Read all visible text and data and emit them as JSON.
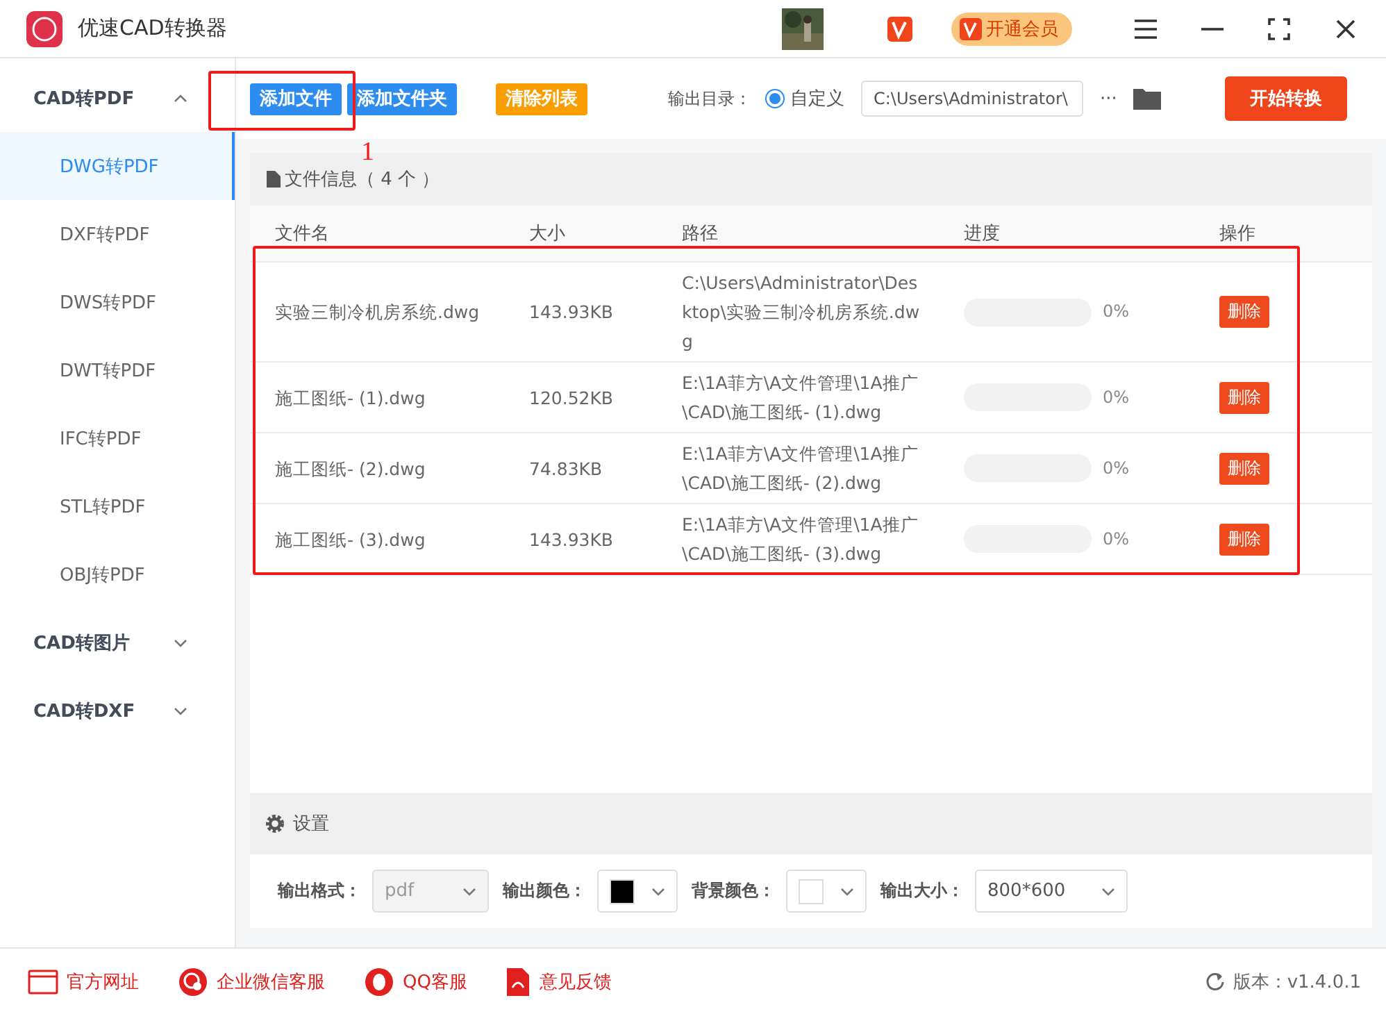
{
  "app": {
    "title": "优速CAD转换器",
    "vip_button": "开通会员"
  },
  "sidebar": {
    "groups": [
      {
        "label": "CAD转PDF",
        "expanded": true,
        "children": [
          {
            "label": "DWG转PDF",
            "selected": true
          },
          {
            "label": "DXF转PDF",
            "selected": false
          },
          {
            "label": "DWS转PDF",
            "selected": false
          },
          {
            "label": "DWT转PDF",
            "selected": false
          },
          {
            "label": "IFC转PDF",
            "selected": false
          },
          {
            "label": "STL转PDF",
            "selected": false
          },
          {
            "label": "OBJ转PDF",
            "selected": false
          }
        ]
      },
      {
        "label": "CAD转图片",
        "expanded": false
      },
      {
        "label": "CAD转DXF",
        "expanded": false
      }
    ]
  },
  "toolbar": {
    "buttons": [
      {
        "label": "添加文件",
        "kind": "primary"
      },
      {
        "label": "添加文件夹",
        "kind": "primary"
      },
      {
        "label": "清除列表",
        "kind": "warning"
      }
    ],
    "output_label": "输出目录：",
    "radio": {
      "label": "自定义",
      "selected": true
    },
    "path": "C:\\Users\\Administrator\\",
    "more": "···",
    "start": "开始转换"
  },
  "annotation": {
    "label": "1"
  },
  "file_info": {
    "title": "文件信息（ 4 个 ）"
  },
  "table": {
    "columns": [
      "文件名",
      "大小",
      "路径",
      "进度",
      "操作"
    ],
    "rows": [
      {
        "name": "实验三制冷机房系统.dwg",
        "size": "143.93KB",
        "path": "C:\\Users\\Administrator\\Desktop\\实验三制冷机房系统.dwg",
        "level": 0,
        "progress": "0%",
        "action": "删除"
      },
      {
        "name": "施工图纸- (1).dwg",
        "size": "120.52KB",
        "path": "E:\\1A菲方\\A文件管理\\1A推广\\CAD\\施工图纸- (1).dwg",
        "level": 0,
        "progress": "0%",
        "action": "删除"
      },
      {
        "name": "施工图纸- (2).dwg",
        "size": "74.83KB",
        "path": "E:\\1A菲方\\A文件管理\\1A推广\\CAD\\施工图纸- (2).dwg",
        "level": 0,
        "progress": "0%",
        "action": "删除"
      },
      {
        "name": "施工图纸- (3).dwg",
        "size": "143.93KB",
        "path": "E:\\1A菲方\\A文件管理\\1A推广\\CAD\\施工图纸- (3).dwg",
        "level": 0,
        "progress": "0%",
        "action": "删除"
      }
    ]
  },
  "settings": {
    "title": "设置",
    "fields": [
      {
        "label": "输出格式：",
        "kind": "select",
        "value": "pdf",
        "disabled": true
      },
      {
        "label": "输出颜色：",
        "kind": "color",
        "color": "#000000"
      },
      {
        "label": "背景颜色：",
        "kind": "color",
        "color": "#ffffff"
      },
      {
        "label": "输出大小：",
        "kind": "select",
        "value": "800*600",
        "disabled": false
      }
    ]
  },
  "footer": {
    "links": [
      {
        "label": "官方网址",
        "kind": "web"
      },
      {
        "label": "企业微信客服",
        "kind": "wechat"
      },
      {
        "label": "QQ客服",
        "kind": "qq"
      },
      {
        "label": "意见反馈",
        "kind": "feedback"
      }
    ],
    "version": "版本：v1.4.0.1"
  }
}
